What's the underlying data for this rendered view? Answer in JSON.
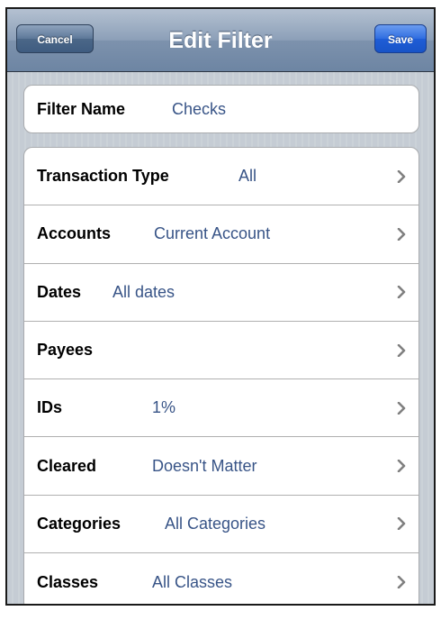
{
  "navbar": {
    "title": "Edit Filter",
    "cancel_label": "Cancel",
    "save_label": "Save"
  },
  "filter_name": {
    "label": "Filter Name",
    "value": "Checks"
  },
  "rows": [
    {
      "label": "Transaction Type",
      "value": "All",
      "icon": "chevron-right-icon"
    },
    {
      "label": "Accounts",
      "value": "Current Account",
      "icon": "chevron-right-icon"
    },
    {
      "label": "Dates",
      "value": "All dates",
      "icon": "chevron-right-icon"
    },
    {
      "label": "Payees",
      "value": "",
      "icon": "chevron-right-icon"
    },
    {
      "label": "IDs",
      "value": "1%",
      "icon": "chevron-right-icon"
    },
    {
      "label": "Cleared",
      "value": "Doesn't Matter",
      "icon": "chevron-right-icon"
    },
    {
      "label": "Categories",
      "value": "All Categories",
      "icon": "chevron-right-icon"
    },
    {
      "label": "Classes",
      "value": "All Classes",
      "icon": "chevron-right-icon"
    }
  ],
  "colors": {
    "nav_bar": "#7d92ad",
    "save_button": "#2f6de1",
    "value_text": "#385487",
    "background_stripes": "#c5ccd4"
  }
}
